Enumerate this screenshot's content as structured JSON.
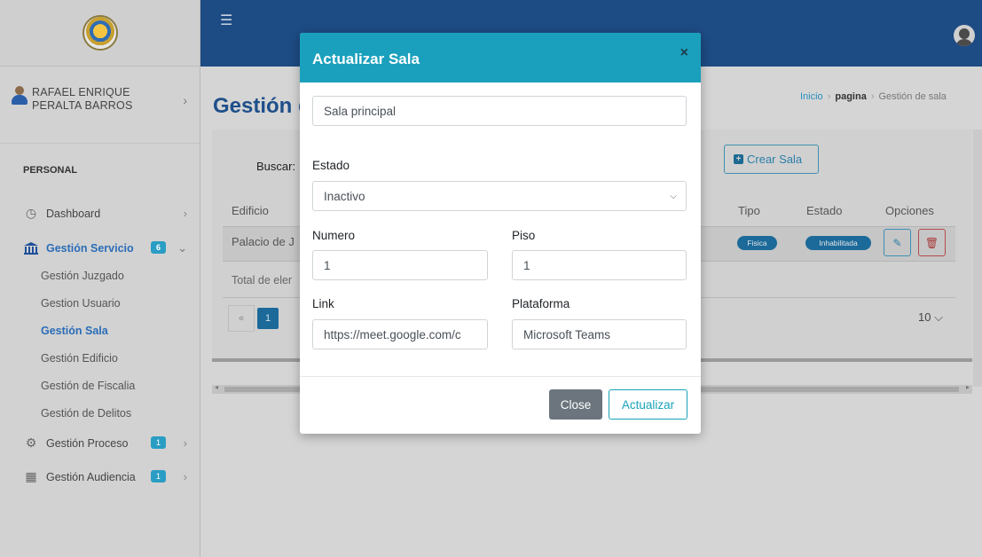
{
  "user": {
    "name_line1": "RAFAEL ENRIQUE",
    "name_line2": "PERALTA BARROS"
  },
  "sidebar": {
    "section": "PERSONAL",
    "items": [
      {
        "label": "Dashboard",
        "icon": "dashboard-icon"
      },
      {
        "label": "Gestión Servicio",
        "icon": "bank-icon",
        "badge": "6"
      },
      {
        "label": "Gestión Proceso",
        "icon": "gears-icon",
        "badge": "1"
      },
      {
        "label": "Gestión Audiencia",
        "icon": "calendar-icon",
        "badge": "1"
      }
    ],
    "subitems": [
      "Gestión Juzgado",
      "Gestion Usuario",
      "Gestión Sala",
      "Gestión Edificio",
      "Gestión de Fiscalia",
      "Gestión de Delitos"
    ]
  },
  "page": {
    "title": "Gestión d",
    "breadcrumb": {
      "home": "Inicio",
      "middle": "pagina",
      "current": "Gestión de sala"
    }
  },
  "table": {
    "search_label": "Buscar:",
    "create_button": "Crear Sala",
    "headers": {
      "edificio": "Edificio",
      "tipo": "Tipo",
      "estado": "Estado",
      "opciones": "Opciones"
    },
    "row": {
      "edificio": "Palacio de J",
      "tipo": "Fisica",
      "estado": "Inhabilitada"
    },
    "total": "Total de eler",
    "pager": {
      "prev": "«",
      "page": "1"
    },
    "per_page": "10"
  },
  "modal": {
    "title": "Actualizar Sala",
    "name_value": "Sala principal",
    "estado_label": "Estado",
    "estado_value": "Inactivo",
    "numero_label": "Numero",
    "numero_value": "1",
    "piso_label": "Piso",
    "piso_value": "1",
    "link_label": "Link",
    "link_value": "https://meet.google.com/c",
    "plataforma_label": "Plataforma",
    "plataforma_value": "Microsoft Teams",
    "close_button": "Close",
    "update_button": "Actualizar"
  },
  "colors": {
    "topbar": "#1d4b84",
    "modal_header": "#1aa0bd",
    "accent": "#17a2b8"
  }
}
